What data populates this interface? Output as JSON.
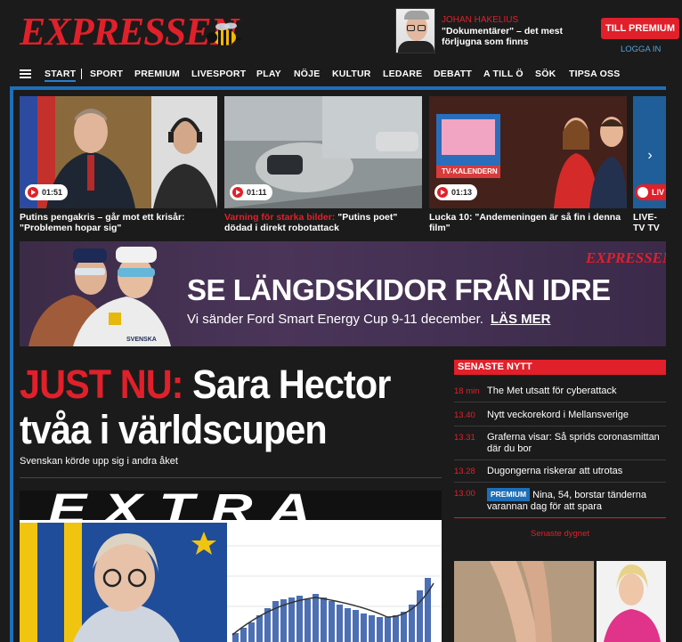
{
  "header": {
    "logo": "EXPRESSEN",
    "author": "JOHAN HAKELIUS",
    "author_headline": "\"Dokumentärer\" – det mest förljugna som finns",
    "premium_button": "TILL PREMIUM",
    "login": "LOGGA IN"
  },
  "nav": {
    "items": [
      "START",
      "SPORT",
      "PREMIUM",
      "LIVESPORT",
      "PLAY",
      "NÖJE",
      "KULTUR",
      "LEDARE",
      "DEBATT",
      "A TILL Ö",
      "SÖK",
      "TIPSA OSS"
    ]
  },
  "videos": [
    {
      "duration": "01:51",
      "kicker": "",
      "title": "Putins pengakris – går mot ett krisår: \"Problemen hopar sig\""
    },
    {
      "duration": "01:11",
      "kicker": "Varning för starka bilder:",
      "title": "\"Putins poet\" dödad i direkt robotattack"
    },
    {
      "duration": "01:13",
      "kicker": "",
      "title": "Lucka 10: \"Andemeningen är så fin i denna film\"",
      "thumb_text": "TV-KALENDERN"
    },
    {
      "duration": "LIV",
      "kicker": "",
      "title": "LIVE-TV TV"
    }
  ],
  "banner": {
    "logo": "EXPRESSEN",
    "title": "SE LÄNGDSKIDOR FRÅN IDRE",
    "subtitle": "Vi sänder Ford Smart Energy Cup 9-11 december.",
    "cta": "LÄS MER",
    "jacket_text": "SVENSKA"
  },
  "main": {
    "kicker": "JUST NU:",
    "headline": "Sara Hector tvåa i världscupen",
    "subheadline": "Svenskan körde upp sig i andra åket",
    "extra_label": "EXTRA"
  },
  "sidebar": {
    "heading": "SENASTE NYTT",
    "items": [
      {
        "time": "18 min",
        "badge": "",
        "text": "The Met utsatt för cyberattack"
      },
      {
        "time": "13.40",
        "badge": "",
        "text": "Nytt veckorekord i Mellansverige"
      },
      {
        "time": "13.31",
        "badge": "",
        "text": "Graferna visar: Så sprids coronasmittan där du bor"
      },
      {
        "time": "13.28",
        "badge": "",
        "text": "Dugongerna riskerar att utrotas"
      },
      {
        "time": "13.00",
        "badge": "PREMIUM",
        "text": "Nina, 54, borstar tänderna varannan dag för att spara"
      }
    ],
    "more": "Senaste dygnet"
  },
  "colors": {
    "brand_red": "#e0202a",
    "accent_blue": "#1e6fb8",
    "background": "#1b1b1b"
  }
}
